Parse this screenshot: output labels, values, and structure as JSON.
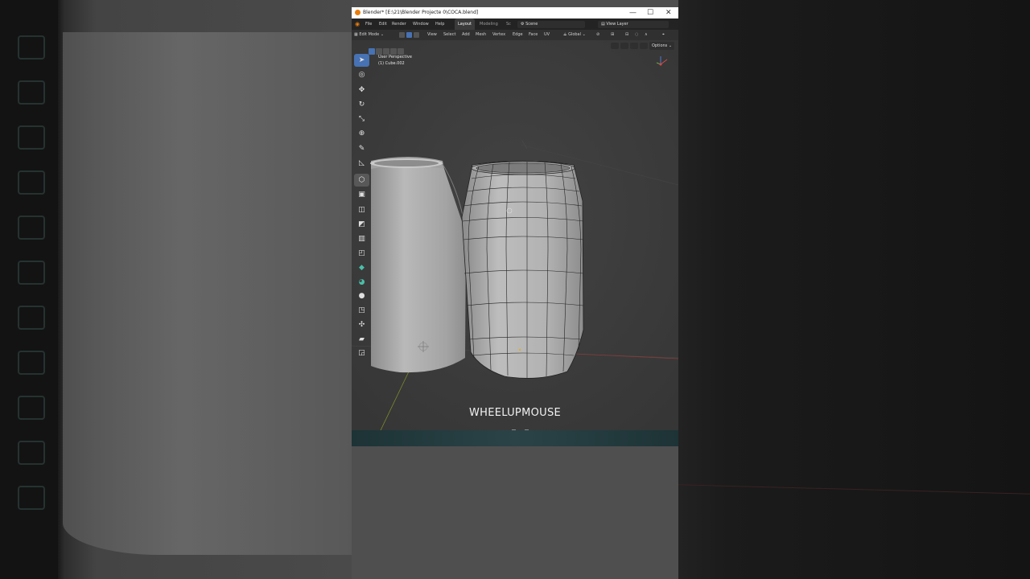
{
  "window": {
    "title": "Blender* [E:\\21\\Blender Projecte 0\\COCA.blend]",
    "controls": {
      "minimize": "—",
      "maximize": "☐",
      "close": "✕"
    }
  },
  "menubar": {
    "items": [
      "File",
      "Edit",
      "Render",
      "Window",
      "Help"
    ],
    "workspaces": [
      "Layout",
      "Modeling",
      "Sc"
    ],
    "active_workspace": "Layout",
    "scene": "Scene",
    "view_layer": "View Layer"
  },
  "header": {
    "mode": "Edit Mode",
    "menus": [
      "View",
      "Select",
      "Add",
      "Mesh",
      "Vertex",
      "Edge",
      "Face",
      "UV"
    ],
    "transform_orientation": "Global"
  },
  "viewport": {
    "view_name": "User Perspective",
    "object_name": "(1) Cube.002",
    "options_label": "Options"
  },
  "toolbar": {
    "tools": [
      {
        "name": "select-box",
        "icon": "cursor-arrow-icon",
        "glyph": "➤",
        "active": true
      },
      {
        "name": "cursor",
        "icon": "3d-cursor-icon",
        "glyph": "◎"
      },
      {
        "name": "move",
        "icon": "move-icon",
        "glyph": "✥"
      },
      {
        "name": "rotate",
        "icon": "rotate-icon",
        "glyph": "↻"
      },
      {
        "name": "scale",
        "icon": "scale-icon",
        "glyph": "⤡"
      },
      {
        "name": "transform",
        "icon": "transform-icon",
        "glyph": "⊕"
      },
      {
        "name": "annotate",
        "icon": "annotate-icon",
        "glyph": "✎"
      },
      {
        "name": "measure",
        "icon": "measure-icon",
        "glyph": "◺"
      },
      {
        "name": "add-cube",
        "icon": "add-cube-icon",
        "glyph": "⬡",
        "selected": true
      },
      {
        "name": "extrude",
        "icon": "extrude-icon",
        "glyph": "▣"
      },
      {
        "name": "inset",
        "icon": "inset-icon",
        "glyph": "◫"
      },
      {
        "name": "bevel",
        "icon": "bevel-icon",
        "glyph": "◩"
      },
      {
        "name": "loop-cut",
        "icon": "loop-cut-icon",
        "glyph": "▥"
      },
      {
        "name": "knife",
        "icon": "knife-icon",
        "glyph": "◰"
      },
      {
        "name": "poly-build",
        "icon": "poly-build-icon",
        "glyph": "◆",
        "teal": true
      },
      {
        "name": "spin",
        "icon": "spin-icon",
        "glyph": "◕",
        "teal": true
      },
      {
        "name": "smooth",
        "icon": "smooth-icon",
        "glyph": "●"
      },
      {
        "name": "edge-slide",
        "icon": "edge-slide-icon",
        "glyph": "◳"
      },
      {
        "name": "shrink-fatten",
        "icon": "shrink-fatten-icon",
        "glyph": "✣"
      },
      {
        "name": "shear",
        "icon": "shear-icon",
        "glyph": "▰"
      },
      {
        "name": "rip",
        "icon": "rip-icon",
        "glyph": "◲"
      }
    ]
  },
  "screencast": {
    "key_label": "WHEELUPMOUSE"
  },
  "colors": {
    "accent": "#4772b3",
    "title_bg": "#ffffff",
    "menubar_bg": "#232323",
    "viewport_bg": "#3d3d3d"
  }
}
